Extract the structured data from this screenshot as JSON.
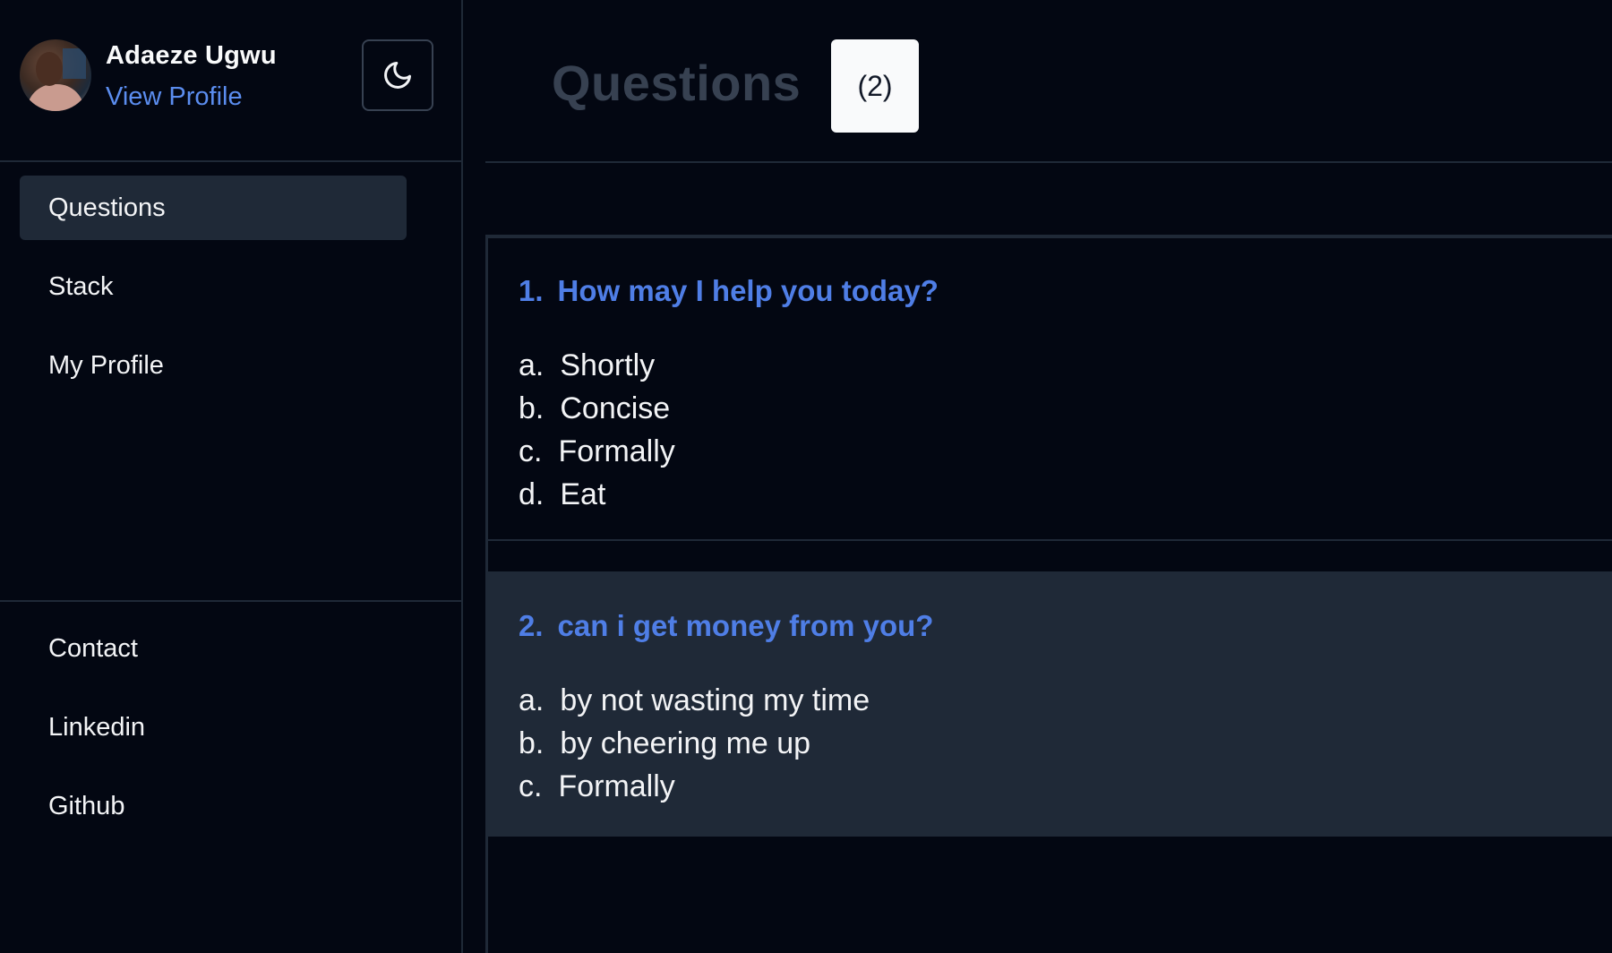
{
  "user": {
    "name": "Adaeze Ugwu",
    "view_profile": "View Profile"
  },
  "theme_toggle": {
    "icon": "moon-icon"
  },
  "nav": {
    "items": [
      {
        "label": "Questions",
        "active": true
      },
      {
        "label": "Stack"
      },
      {
        "label": "My Profile"
      }
    ],
    "footer_items": [
      {
        "label": "Contact"
      },
      {
        "label": "Linkedin"
      },
      {
        "label": "Github"
      }
    ]
  },
  "header": {
    "title": "Questions",
    "count": "(2)"
  },
  "questions": [
    {
      "number": "1.",
      "text": "How may I help you today?",
      "options": [
        {
          "letter": "a.",
          "text": "Shortly"
        },
        {
          "letter": "b.",
          "text": "Concise"
        },
        {
          "letter": "c.",
          "text": "Formally"
        },
        {
          "letter": "d.",
          "text": "Eat"
        }
      ]
    },
    {
      "number": "2.",
      "text": "can i get money from you?",
      "options": [
        {
          "letter": "a.",
          "text": "by not wasting my time"
        },
        {
          "letter": "b.",
          "text": "by cheering me up"
        },
        {
          "letter": "c.",
          "text": "Formally"
        }
      ]
    }
  ],
  "colors": {
    "background": "#030712",
    "surface": "#1f2937",
    "accent": "#5b8def",
    "question_title": "#4f7ee6"
  }
}
